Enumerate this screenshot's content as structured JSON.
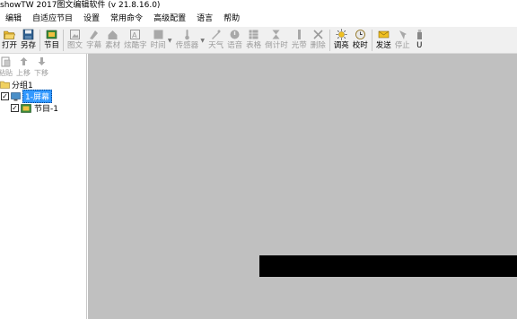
{
  "window": {
    "title": "showTW 2017图文编辑软件 (v 21.8.16.0)"
  },
  "menu": [
    "编辑",
    "自适应节目",
    "设置",
    "常用命令",
    "高级配置",
    "语言",
    "帮助"
  ],
  "toolbar": {
    "open": "打开",
    "save_as": "另存",
    "program": "节目",
    "image_text": "图文",
    "subtitle": "字幕",
    "material": "素材",
    "dazzle_text": "炫酷字",
    "time": "时间",
    "sensor": "传感器",
    "weather": "天气",
    "voice": "语音",
    "table": "表格",
    "countdown": "倒计时",
    "lightbar": "光带",
    "delete": "删除",
    "brightness": "调亮",
    "calibrate": "校时",
    "send": "发送",
    "stop": "停止",
    "u_disk": "U"
  },
  "left_panel": {
    "toolbar": {
      "paste": "粘贴",
      "move_up": "上移",
      "move_down": "下移"
    },
    "tree": {
      "group": "分组1",
      "screen": "1-屏幕",
      "program": "节目-1",
      "screen_checked": true,
      "program_checked": true
    }
  },
  "colors": {
    "workspace_bg": "#c0c0c0",
    "selection": "#3399ff",
    "text_area": "#000000"
  }
}
